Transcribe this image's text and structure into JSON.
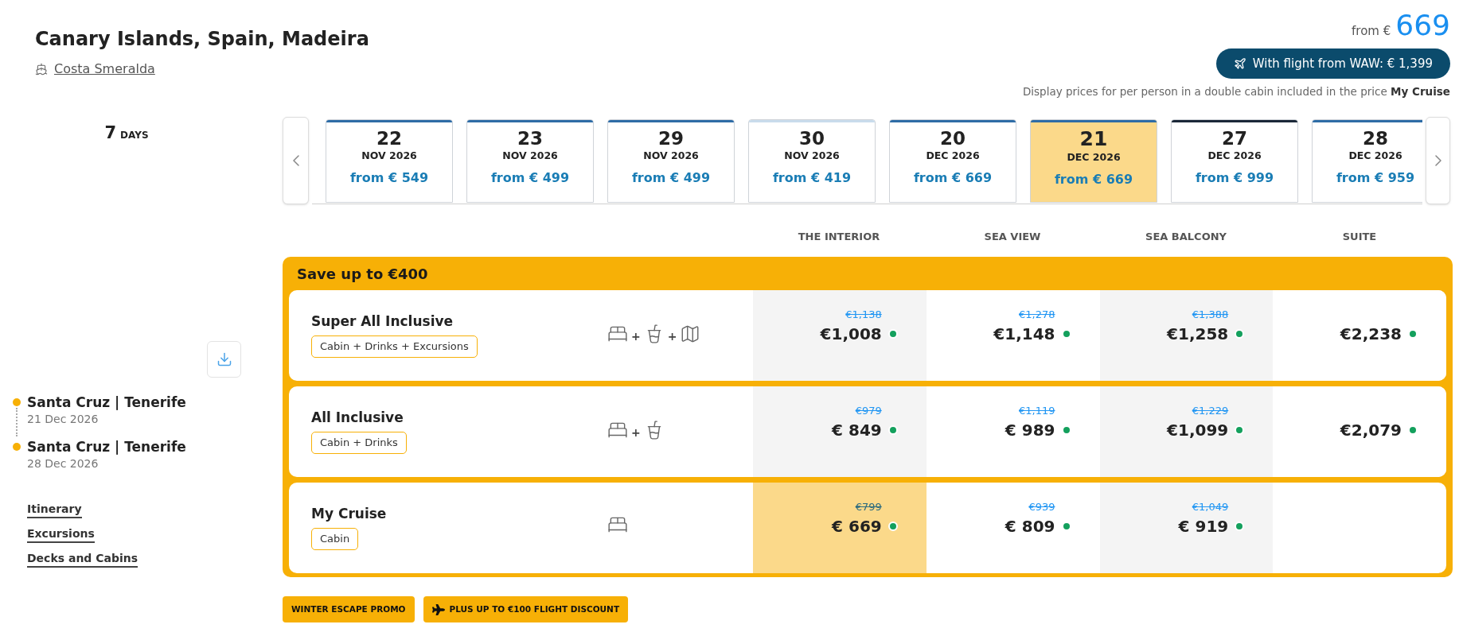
{
  "header": {
    "title": "Canary Islands, Spain, Madeira",
    "ship": "Costa Smeralda",
    "price_prefix": "from €",
    "price": "669",
    "flight_button": "With flight from WAW: € 1,399",
    "note": "Display prices for per person in a double cabin included in the price **My Cruise**"
  },
  "duration": {
    "number": "7",
    "unit": "DAYS"
  },
  "dates": [
    {
      "day": "22",
      "month": "NOV 2026",
      "price": "from € 549",
      "color": "#2e6ca6",
      "selected": false
    },
    {
      "day": "23",
      "month": "NOV 2026",
      "price": "from € 499",
      "color": "#2e6ca6",
      "selected": false
    },
    {
      "day": "29",
      "month": "NOV 2026",
      "price": "from € 499",
      "color": "#2e6ca6",
      "selected": false
    },
    {
      "day": "30",
      "month": "NOV 2026",
      "price": "from € 419",
      "color": "#c9dcec",
      "selected": false
    },
    {
      "day": "20",
      "month": "DEC 2026",
      "price": "from € 669",
      "color": "#2e6ca6",
      "selected": false
    },
    {
      "day": "21",
      "month": "DEC 2026",
      "price": "from € 669",
      "color": "#2e6ca6",
      "selected": true
    },
    {
      "day": "27",
      "month": "DEC 2026",
      "price": "from € 999",
      "color": "#1b2838",
      "selected": false
    },
    {
      "day": "28",
      "month": "DEC 2026",
      "price": "from € 959",
      "color": "#2e6ca6",
      "selected": false
    }
  ],
  "cabin_columns": [
    "THE INTERIOR",
    "SEA VIEW",
    "SEA BALCONY",
    "SUITE"
  ],
  "offer": {
    "banner": "Save up to €400",
    "packages": [
      {
        "name": "Super All Inclusive",
        "includes": "Cabin + Drinks + Excursions",
        "icons": [
          {
            "kind": "bed"
          },
          {
            "kind": "plus",
            "text": "+"
          },
          {
            "kind": "drink"
          },
          {
            "kind": "plus",
            "text": "+"
          },
          {
            "kind": "map"
          }
        ],
        "prices": [
          {
            "old": "€1,138",
            "price": "€1,008",
            "selected": false,
            "available": true
          },
          {
            "old": "€1,278",
            "price": "€1,148",
            "selected": false,
            "available": true
          },
          {
            "old": "€1,388",
            "price": "€1,258",
            "selected": false,
            "available": true
          },
          {
            "price": "€2,238",
            "selected": false,
            "available": true
          }
        ]
      },
      {
        "name": "All Inclusive",
        "includes": "Cabin + Drinks",
        "icons": [
          {
            "kind": "bed"
          },
          {
            "kind": "plus",
            "text": "+"
          },
          {
            "kind": "drink"
          }
        ],
        "prices": [
          {
            "old": "€979",
            "price": "€ 849",
            "selected": false,
            "available": true
          },
          {
            "old": "€1,119",
            "price": "€ 989",
            "selected": false,
            "available": true
          },
          {
            "old": "€1,229",
            "price": "€1,099",
            "selected": false,
            "available": true
          },
          {
            "price": "€2,079",
            "selected": false,
            "available": true
          }
        ]
      },
      {
        "name": "My Cruise",
        "includes": "Cabin",
        "icons": [
          {
            "kind": "bed"
          }
        ],
        "prices": [
          {
            "old": "€799",
            "price": "€ 669",
            "selected": true,
            "available": true
          },
          {
            "old": "€939",
            "price": "€ 809",
            "selected": false,
            "available": true
          },
          {
            "old": "€1,049",
            "price": "€ 919",
            "selected": false,
            "available": true
          }
        ]
      }
    ]
  },
  "itinerary": [
    {
      "port": "Santa Cruz | Tenerife",
      "date": "21 Dec 2026"
    },
    {
      "port": "Santa Cruz | Tenerife",
      "date": "28 Dec 2026"
    }
  ],
  "links": [
    "Itinerary",
    "Excursions",
    "Decks and Cabins"
  ],
  "promos": [
    {
      "kind": "plain",
      "label": "WINTER ESCAPE PROMO"
    },
    {
      "kind": "flight",
      "label": "PLUS UP TO €100 FLIGHT DISCOUNT"
    }
  ]
}
